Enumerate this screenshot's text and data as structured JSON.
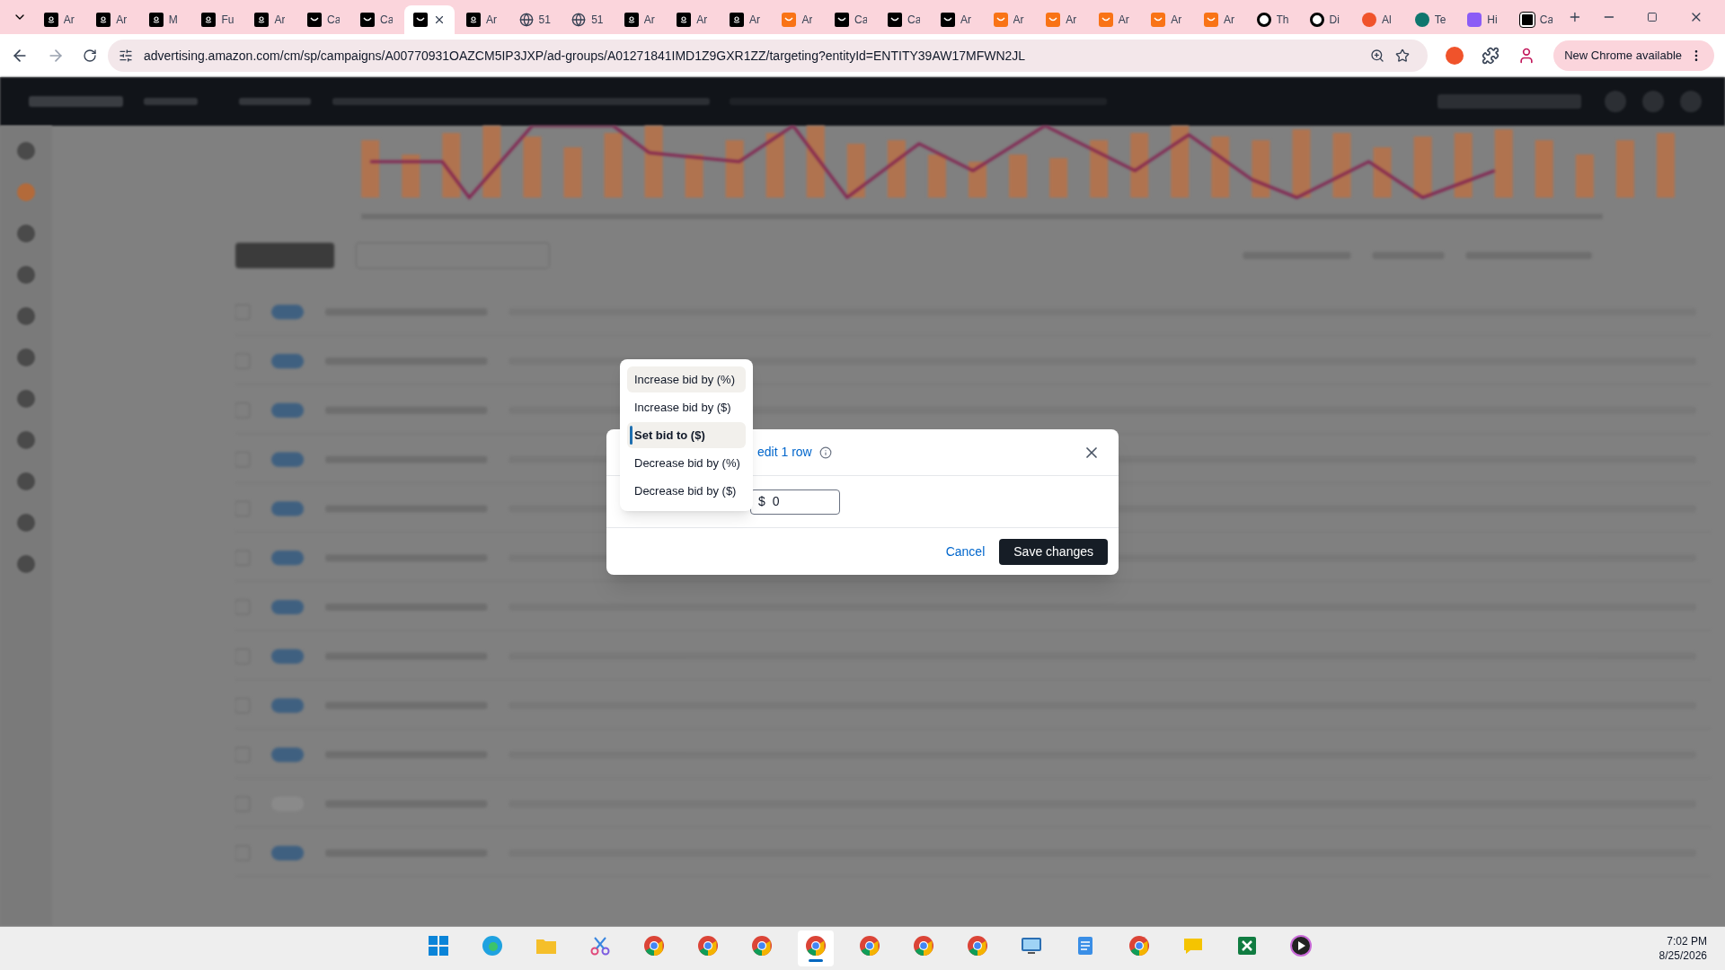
{
  "browser": {
    "tabs": [
      {
        "kind": "amazon",
        "title": "Ar",
        "selected": false
      },
      {
        "kind": "amazon",
        "title": "Ar",
        "selected": false
      },
      {
        "kind": "amazon",
        "title": "M",
        "selected": false
      },
      {
        "kind": "amazon",
        "title": "Fu",
        "selected": false
      },
      {
        "kind": "amazon",
        "title": "Ar",
        "selected": false
      },
      {
        "kind": "dark",
        "title": "Ca",
        "selected": false
      },
      {
        "kind": "dark",
        "title": "Ca",
        "selected": false
      },
      {
        "kind": "dark",
        "selected": true
      },
      {
        "kind": "amazon",
        "title": "Ar",
        "selected": false
      },
      {
        "kind": "globe",
        "title": "51",
        "selected": false
      },
      {
        "kind": "globe",
        "title": "51",
        "selected": false
      },
      {
        "kind": "amazon",
        "title": "Ar",
        "selected": false
      },
      {
        "kind": "amazon",
        "title": "Ar",
        "selected": false
      },
      {
        "kind": "amazon",
        "title": "Ar",
        "selected": false
      },
      {
        "kind": "orange",
        "title": "Ar",
        "selected": false
      },
      {
        "kind": "dark",
        "title": "Ca",
        "selected": false
      },
      {
        "kind": "dark",
        "title": "Ca",
        "selected": false
      },
      {
        "kind": "dark",
        "title": "Ar",
        "selected": false
      },
      {
        "kind": "orange",
        "title": "Ar",
        "selected": false
      },
      {
        "kind": "orange",
        "title": "Ar",
        "selected": false
      },
      {
        "kind": "orange",
        "title": "Ar",
        "selected": false
      },
      {
        "kind": "orange",
        "title": "Ar",
        "selected": false
      },
      {
        "kind": "orange",
        "title": "Ar",
        "selected": false
      },
      {
        "kind": "ring",
        "title": "Th",
        "selected": false
      },
      {
        "kind": "ring",
        "title": "Di",
        "selected": false
      },
      {
        "kind": "redt",
        "title": "Al",
        "selected": false
      },
      {
        "kind": "teal",
        "title": "Te",
        "selected": false
      },
      {
        "kind": "purple",
        "title": "Hi",
        "selected": false
      },
      {
        "kind": "grid",
        "title": "Ca",
        "selected": false
      }
    ],
    "url": "advertising.amazon.com/cm/sp/campaigns/A00770931OAZCM5IP3JXP/ad-groups/A01271841IMD1Z9GXR1ZZ/targeting?entityId=ENTITY39AW17MFWN2JL",
    "update_button": "New Chrome available"
  },
  "dialog": {
    "title": "edit 1 row",
    "bid_field": {
      "prefix": "$",
      "value": "0"
    },
    "cancel": "Cancel",
    "save": "Save changes"
  },
  "bid_menu": {
    "items": [
      {
        "label": "Increase bid by (%)",
        "selected": false,
        "hovered": true
      },
      {
        "label": "Increase bid by ($)",
        "selected": false,
        "hovered": false
      },
      {
        "label": "Set bid to ($)",
        "selected": true,
        "hovered": false
      },
      {
        "label": "Decrease bid by (%)",
        "selected": false,
        "hovered": false
      },
      {
        "label": "Decrease bid by ($)",
        "selected": false,
        "hovered": false
      }
    ]
  },
  "taskbar": {
    "apps": [
      {
        "kind": "windows",
        "active": false
      },
      {
        "kind": "edge",
        "active": false
      },
      {
        "kind": "folder",
        "active": false
      },
      {
        "kind": "snip",
        "active": false
      },
      {
        "kind": "chrome",
        "active": false
      },
      {
        "kind": "chrome",
        "active": false
      },
      {
        "kind": "chrome",
        "active": false
      },
      {
        "kind": "chrome",
        "active": true
      },
      {
        "kind": "chrome",
        "active": false
      },
      {
        "kind": "chrome",
        "active": false
      },
      {
        "kind": "chrome",
        "active": false
      },
      {
        "kind": "monitor",
        "active": false
      },
      {
        "kind": "notepad",
        "active": false
      },
      {
        "kind": "chrome",
        "active": false
      },
      {
        "kind": "chat",
        "active": false
      },
      {
        "kind": "excel",
        "active": false
      },
      {
        "kind": "player",
        "active": false
      }
    ],
    "time": "7:02 PM",
    "date": "8/25/2026"
  }
}
